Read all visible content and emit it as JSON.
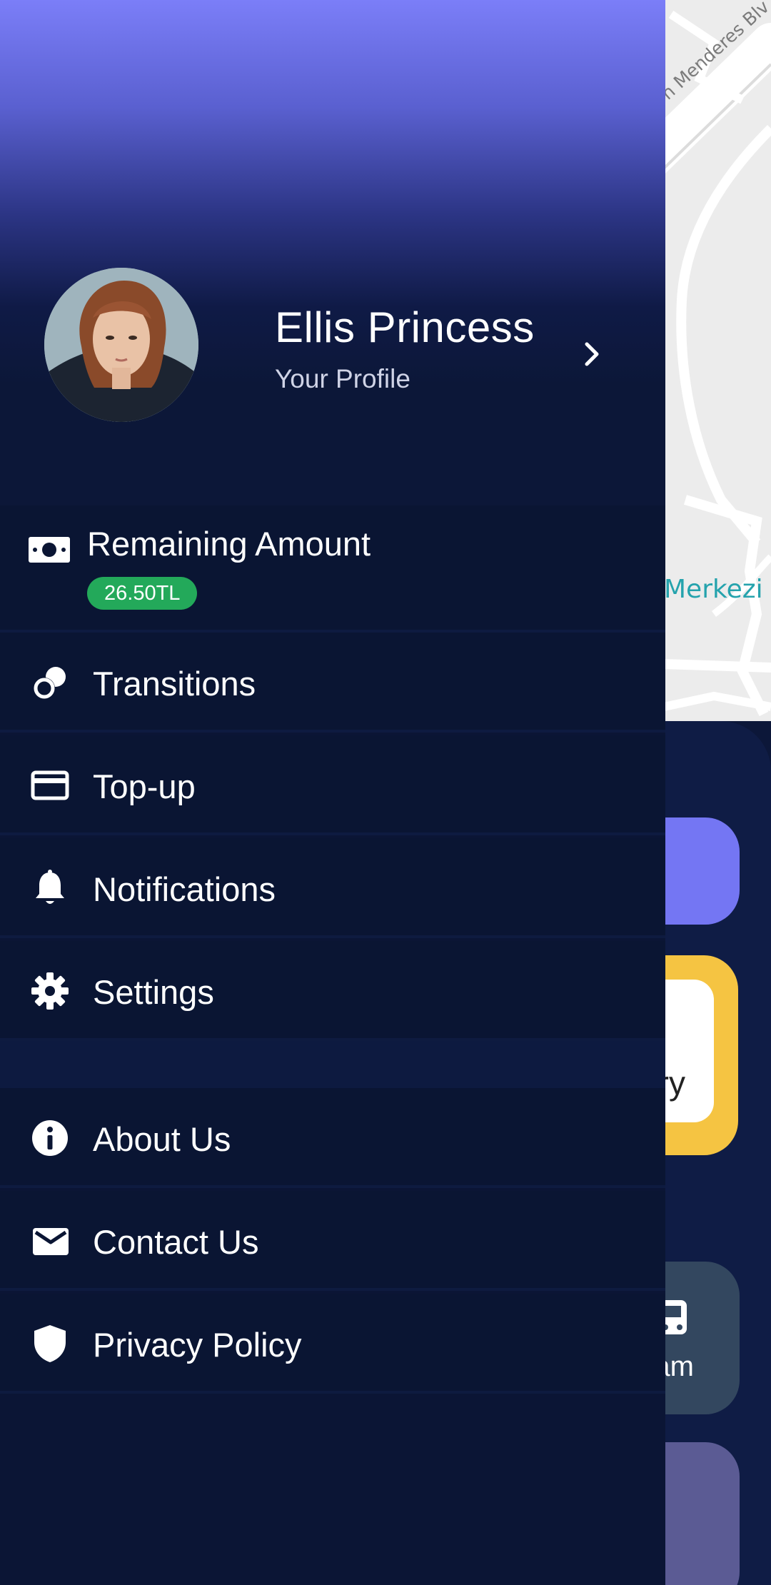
{
  "map": {
    "road_label": "n Menderes Blv",
    "place_label": "Merkezi"
  },
  "background_cards": {
    "yellow_text": "ry",
    "slate_text": "am"
  },
  "profile": {
    "name": "Ellis Princess",
    "subtitle": "Your Profile"
  },
  "balance": {
    "label": "Remaining Amount",
    "amount": "26.50TL",
    "badge_color": "#23a95a"
  },
  "menu": {
    "transitions": {
      "label": "Transitions",
      "icon": "coins-icon"
    },
    "topup": {
      "label": "Top-up",
      "icon": "credit-card-icon"
    },
    "notifications": {
      "label": "Notifications",
      "icon": "bell-icon"
    },
    "settings": {
      "label": "Settings",
      "icon": "gear-icon"
    },
    "about": {
      "label": "About Us",
      "icon": "info-icon"
    },
    "contact": {
      "label": "Contact Us",
      "icon": "envelope-icon"
    },
    "privacy": {
      "label": "Privacy Policy",
      "icon": "shield-icon"
    }
  },
  "colors": {
    "header_gradient_top": "#7b7ef8",
    "drawer_background": "#0b1535",
    "accent_purple": "#7476f3",
    "accent_yellow": "#f5c442"
  }
}
